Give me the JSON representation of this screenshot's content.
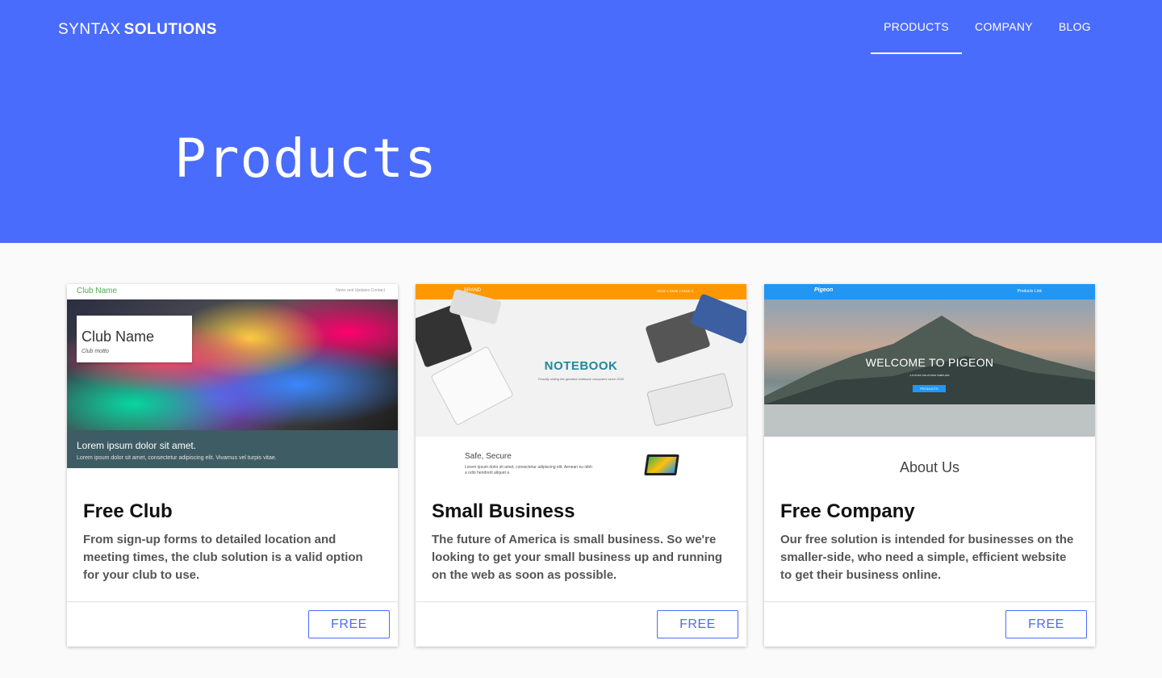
{
  "header": {
    "brand_part1": "SYNTAX",
    "brand_part2": "SOLUTIONS",
    "nav": [
      {
        "label": "PRODUCTS",
        "active": true
      },
      {
        "label": "COMPANY",
        "active": false
      },
      {
        "label": "BLOG",
        "active": false
      }
    ],
    "page_title": "Products"
  },
  "colors": {
    "primary": "#4a6cfc",
    "background": "#fafafa"
  },
  "cards": [
    {
      "title": "Free Club",
      "description": "From sign-up forms to detailed location and meeting times, the club solution is a valid option for your club to use.",
      "button": "FREE",
      "thumb": {
        "nav_name": "Club Name",
        "nav_links": "News and Updates    Contact",
        "box_title": "Club Name",
        "box_motto": "Club motto",
        "band_heading": "Lorem ipsum dolor sit amet.",
        "band_text": "Lorem ipsum dolor sit amet, consectetur adipiscing elit. Vivamus vel turpis vitae."
      }
    },
    {
      "title": "Small Business",
      "description": "The future of America is small business. So we're looking to get your small business up and running on the web as soon as possible.",
      "button": "FREE",
      "thumb": {
        "nav_brand": "BRAND",
        "nav_links": "PAGE 1    PAGE 2    PAGE 3",
        "hero_title": "NOTEBOOK",
        "hero_sub": "Proudly selling the greatest notebook computers since 2020",
        "section_heading": "Safe, Secure",
        "section_text": "Lorem ipsum dolor sit amet, consectetur adipiscing elit. Aenean eu nibh a odio hendrerit aliquet a"
      }
    },
    {
      "title": "Free Company",
      "description": "Our free solution is intended for businesses on the smaller-side, who need a simple, efficient website to get their business online.",
      "button": "FREE",
      "thumb": {
        "nav_brand": "Pigeon",
        "nav_links": "Products    Link",
        "hero_title": "WELCOME TO PIGEON",
        "hero_sub": "A SYNTAX SOLUTIONS TEMPLATE",
        "hero_button": "PRODUCTS",
        "section_heading": "About Us"
      }
    }
  ]
}
